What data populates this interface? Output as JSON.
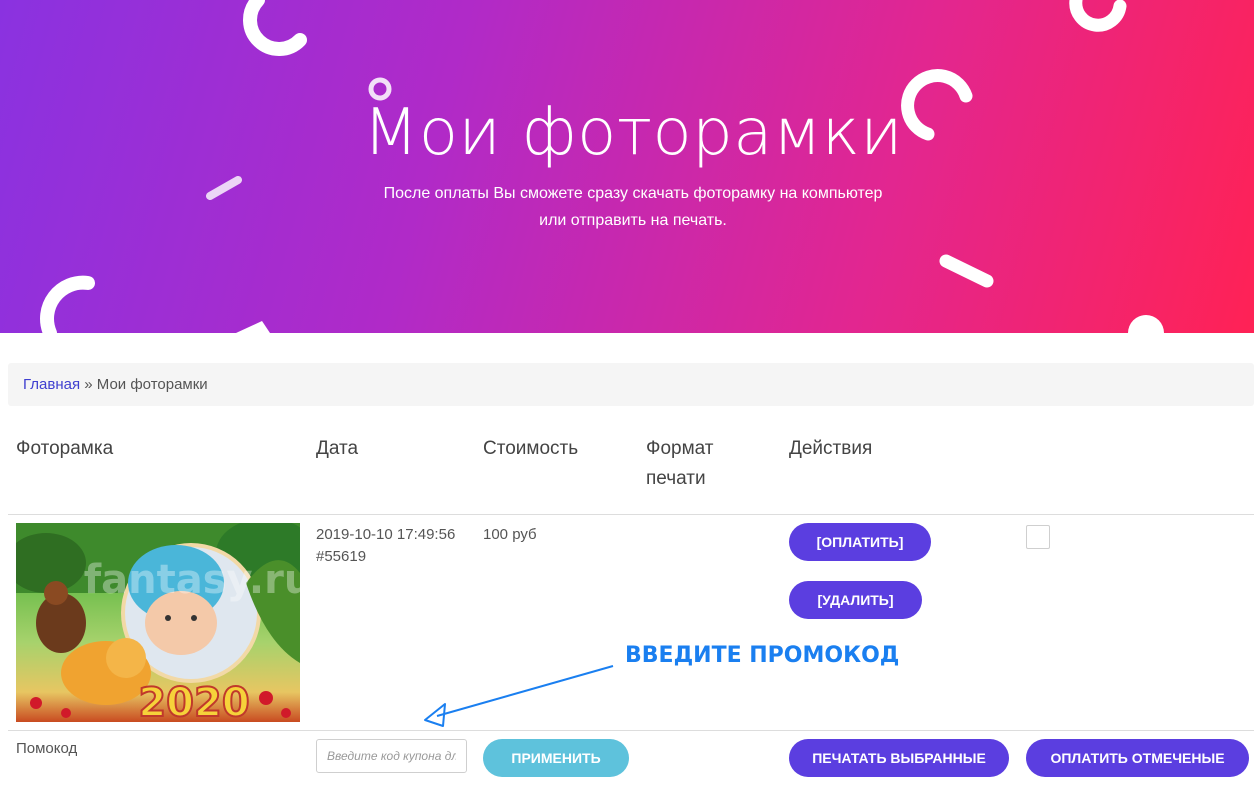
{
  "hero": {
    "title": "Мои фоторамки",
    "subtitle_line1": "После оплаты Вы сможете сразу скачать фоторамку на компьютер",
    "subtitle_line2": "или отправить на печать."
  },
  "breadcrumb": {
    "home": "Главная",
    "separator": " » ",
    "current": "Мои фоторамки"
  },
  "table": {
    "headers": {
      "frame": "Фоторамка",
      "date": "Дата",
      "cost": "Стоимость",
      "format_line1": "Формат",
      "format_line2": "печати",
      "actions": "Действия"
    },
    "rows": [
      {
        "thumbnail_text": "2020",
        "thumbnail_watermark": "fantasy.ru",
        "date": "2019-10-10 17:49:56",
        "order_id": "#55619",
        "cost": "100 руб",
        "pay_label": "[ОПЛАТИТЬ]",
        "delete_label": "[УДАЛИТЬ]",
        "selected": false
      }
    ]
  },
  "annotation": {
    "text": "ВВЕДИТЕ ПРОМОКОД",
    "color": "#1a7ff0"
  },
  "promo": {
    "label": "Помокод",
    "placeholder": "Введите код купона дл",
    "value": "",
    "apply_label": "ПРИМЕНИТЬ"
  },
  "footer_actions": {
    "print_selected_label": "ПЕЧАТАТЬ ВЫБРАННЫЕ",
    "pay_marked_label": "ОПЛАТИТЬ ОТМЕЧЕНЫЕ"
  },
  "colors": {
    "hero_gradient_start": "#8a32e0",
    "hero_gradient_end": "#ff2255",
    "primary_button": "#5b3ee0",
    "apply_button": "#5ec2dc",
    "link": "#3f3fd0"
  }
}
